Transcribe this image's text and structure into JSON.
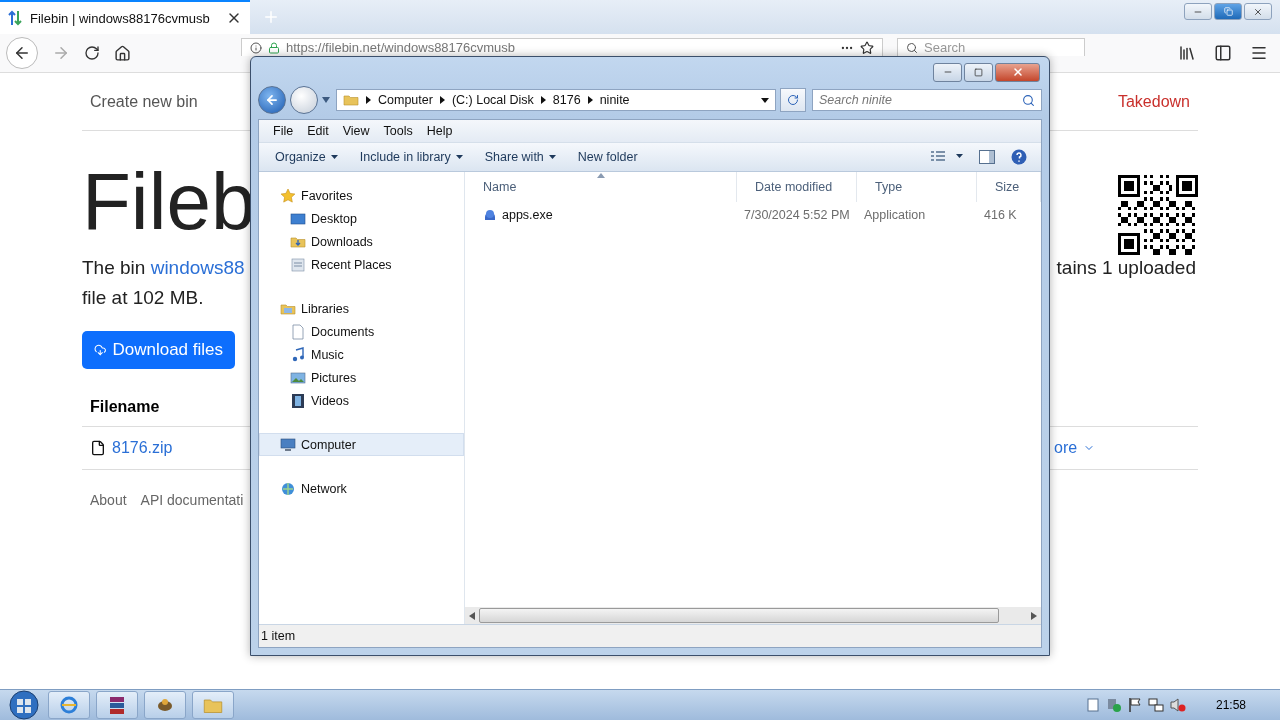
{
  "browser": {
    "tabs": [
      {
        "title": "Filebin | windows88176cvmusb",
        "selected": true
      }
    ],
    "url": "https://filebin.net/windows88176cvmusb",
    "search": {
      "placeholder": "Search"
    }
  },
  "page": {
    "nav_left": "Create new bin",
    "nav_right": "Takedown",
    "heading": "Fileb",
    "intro": {
      "lead": "The bin",
      "link": "windows88",
      "line2": "file at 102 MB.",
      "right": "tains 1 uploaded"
    },
    "download_button": "Download files",
    "table": {
      "header": "Filename",
      "file": "8176.zip",
      "more": "ore"
    },
    "footer": [
      "About",
      "API documentati"
    ]
  },
  "explorer": {
    "breadcrumb": [
      "Computer",
      "(C:) Local Disk",
      "8176",
      "ninite"
    ],
    "search": {
      "placeholder": "Search ninite"
    },
    "menu": [
      "File",
      "Edit",
      "View",
      "Tools",
      "Help"
    ],
    "commands": [
      {
        "label": "Organize",
        "dropdown": true
      },
      {
        "label": "Include in library",
        "dropdown": true
      },
      {
        "label": "Share with",
        "dropdown": true
      },
      {
        "label": "New folder",
        "dropdown": false
      }
    ],
    "tree": [
      {
        "label": "Favorites",
        "selected": false,
        "children": [
          {
            "label": "Desktop",
            "selected": false
          },
          {
            "label": "Downloads",
            "selected": false
          },
          {
            "label": "Recent Places",
            "selected": false
          }
        ]
      },
      {
        "label": "Libraries",
        "selected": false,
        "children": [
          {
            "label": "Documents",
            "selected": false
          },
          {
            "label": "Music",
            "selected": false
          },
          {
            "label": "Pictures",
            "selected": false
          },
          {
            "label": "Videos",
            "selected": false
          }
        ]
      },
      {
        "label": "Computer",
        "selected": true
      },
      {
        "label": "Network",
        "selected": false
      }
    ],
    "columns": [
      {
        "label": "Name",
        "sorted": true
      },
      {
        "label": "Date modified",
        "sorted": false
      },
      {
        "label": "Type",
        "sorted": false
      },
      {
        "label": "Size",
        "sorted": false
      }
    ],
    "rows": [
      {
        "cells": [
          "apps.exe",
          "7/30/2024 5:52 PM",
          "Application",
          "416 K"
        ],
        "selected": false
      }
    ],
    "status": "1 item"
  },
  "taskbar": {
    "clock": "21:58"
  }
}
